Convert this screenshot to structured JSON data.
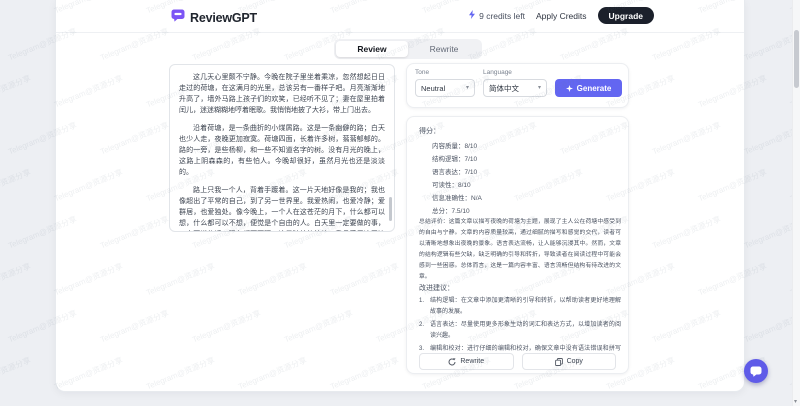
{
  "watermark": {
    "text": "Telegram@资源分享"
  },
  "header": {
    "brand": "ReviewGPT",
    "credits": "9 credits left",
    "apply_credits": "Apply Credits",
    "upgrade": "Upgrade"
  },
  "tabs": {
    "review": "Review",
    "rewrite": "Rewrite"
  },
  "editor": {
    "paragraphs": [
      "这几天心里颇不宁静。今晚在院子里坐着乘凉，忽然想起日日走过的荷塘，在这满月的光里，总该另有一番样子吧。月亮渐渐地升高了，墙外马路上孩子们的欢笑，已经听不见了；妻在屋里拍着闰儿，迷迷糊糊地哼着眠歌。我悄悄地披了大衫，带上门出去。",
      "沿着荷塘，是一条曲折的小煤屑路。这是一条幽僻的路；白天也少人走，夜晚更加寂寞。荷塘四面，长着许多树，蓊蓊郁郁的。路的一旁，是些杨柳，和一些不知道名字的树。没有月光的晚上，这路上阴森森的，有些怕人。今晚却很好，虽然月光也还是淡淡的。",
      "路上只我一个人，背着手踱着。这一片天地好像是我的；我也像超出了平常的自己，到了另一世界里。我爱热闹，也爱冷静；爱群居，也爱独处。像今晚上，一个人在这苍茫的月下，什么都可以想，什么都可以不想，便觉是个自由的人。白天里一定要做的事，一定要说的话，现在都可不理。这是独处的妙处，我且受用这无边的荷香月色好了。"
    ]
  },
  "controls": {
    "tone_label": "Tone",
    "tone_value": "Neutral",
    "language_label": "Language",
    "language_value": "简体中文",
    "generate": "Generate"
  },
  "results": {
    "score_heading": "得分：",
    "scores": [
      "内容质量：8/10",
      "结构逻辑：7/10",
      "语言表达：7/10",
      "可读性：8/10",
      "信息准确性：N/A",
      "总分：7.5/10"
    ],
    "summary": "总结评价：这篇文章以描写夜晚的荷塘为主题，展现了主人公在荷塘中感受到的自由与宁静。文章的内容质量较高，通过细腻的描写和感觉的交代，读者可以清晰地想象出夜晚的景象。语言表达流畅，让人能够沉浸其中。然而，文章的结构逻辑有些欠缺，缺乏明确的引导和转折，导致读者在阅读过程中可能会感到一些困惑。总体而言，这是一篇内容丰富、语言流畅但结构有待改进的文章。",
    "suggest_heading": "改进建议：",
    "suggestions": [
      {
        "num": "1.",
        "text": "结构逻辑：在文章中添加更清晰的引导和转折，以帮助读者更好地理解故事的发展。"
      },
      {
        "num": "2.",
        "text": "语言表达：尽量使用更多形象生动的词汇和表达方式，以增加读者的阅读兴趣。"
      },
      {
        "num": "3.",
        "text": "编辑和校对：进行仔细的编辑和校对，确保文章中没有语法错误和拼写错误，以提高整体质量。"
      }
    ],
    "rewrite": "Rewrite",
    "copy": "Copy"
  },
  "colors": {
    "accent": "#6366f1",
    "brand_purple": "#7c55f5",
    "upgrade_dark": "#1b202b"
  }
}
